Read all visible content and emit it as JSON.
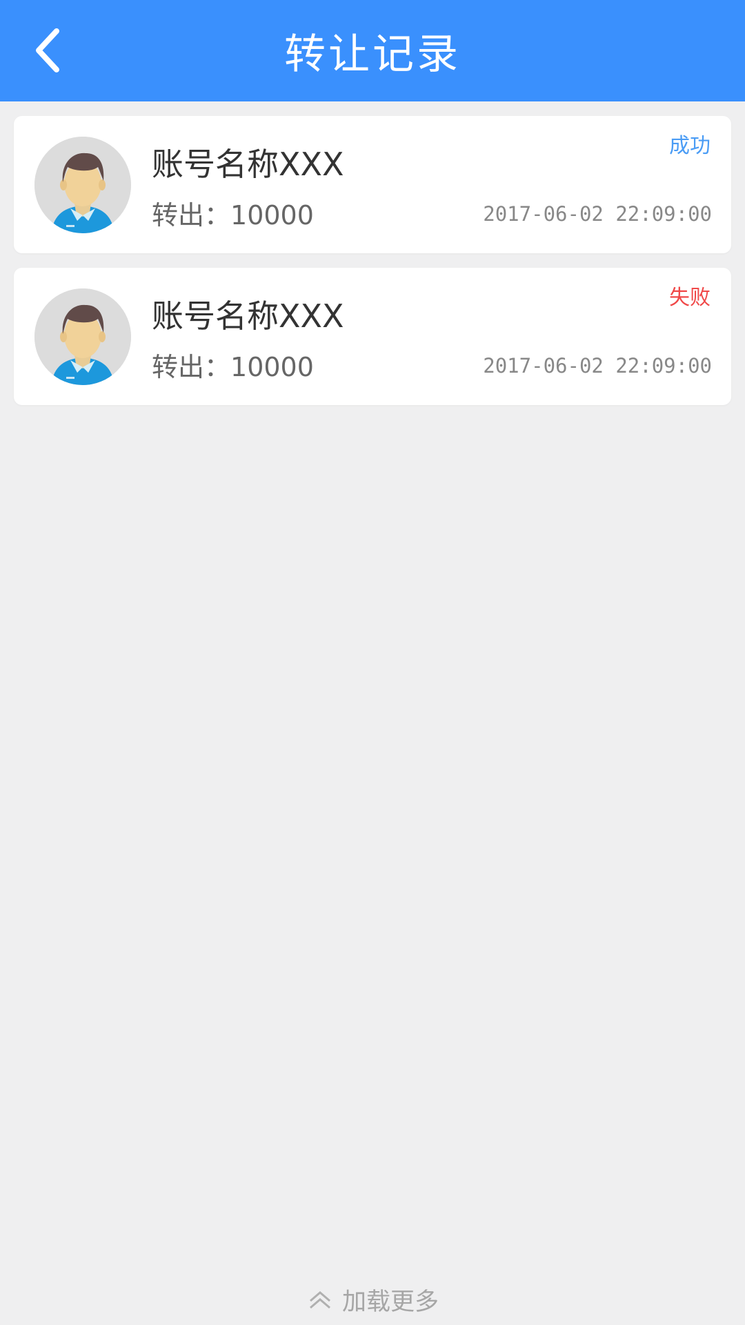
{
  "header": {
    "title": "转让记录",
    "back_icon": "chevron-left-icon"
  },
  "records": [
    {
      "name": "账号名称XXX",
      "transfer_label": "转出：",
      "amount": "10000",
      "status": "成功",
      "status_color": "#4a9cf5",
      "time": "2017-06-02 22:09:00"
    },
    {
      "name": "账号名称XXX",
      "transfer_label": "转出：",
      "amount": "10000",
      "status": "失败",
      "status_color": "#f04848",
      "time": "2017-06-02 22:09:00"
    }
  ],
  "footer": {
    "load_more": "加载更多",
    "load_more_icon": "double-chevron-up-icon"
  },
  "colors": {
    "accent": "#3a90fd",
    "background": "#efeff0"
  }
}
